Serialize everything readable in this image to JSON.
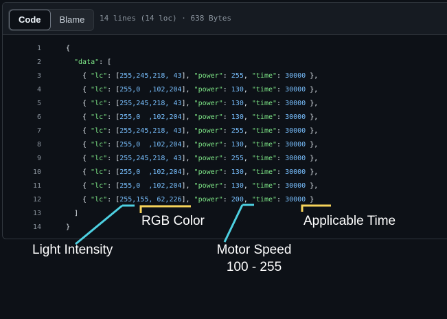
{
  "toolbar": {
    "tabs": [
      {
        "label": "Code",
        "active": true
      },
      {
        "label": "Blame",
        "active": false
      }
    ],
    "file_info": "14 lines (14 loc) · 638 Bytes"
  },
  "code_lines": [
    {
      "n": "1",
      "tokens": [
        [
          "pun",
          "{"
        ]
      ],
      "indent": 0
    },
    {
      "n": "2",
      "tokens": [
        [
          "key",
          "\"data\""
        ],
        [
          "pun",
          ": ["
        ]
      ],
      "indent": 1
    },
    {
      "n": "3",
      "tokens": [
        [
          "pun",
          "{ "
        ],
        [
          "key",
          "\"lc\""
        ],
        [
          "pun",
          ": ["
        ],
        [
          "num",
          "255,245,218, 43"
        ],
        [
          "pun",
          "], "
        ],
        [
          "key",
          "\"power\""
        ],
        [
          "pun",
          ": "
        ],
        [
          "num",
          "255"
        ],
        [
          "pun",
          ", "
        ],
        [
          "key",
          "\"time\""
        ],
        [
          "pun",
          ": "
        ],
        [
          "num",
          "30000"
        ],
        [
          "pun",
          " },"
        ]
      ],
      "indent": 2
    },
    {
      "n": "4",
      "tokens": [
        [
          "pun",
          "{ "
        ],
        [
          "key",
          "\"lc\""
        ],
        [
          "pun",
          ": ["
        ],
        [
          "num",
          "255,0  ,102,204"
        ],
        [
          "pun",
          "], "
        ],
        [
          "key",
          "\"power\""
        ],
        [
          "pun",
          ": "
        ],
        [
          "num",
          "130"
        ],
        [
          "pun",
          ", "
        ],
        [
          "key",
          "\"time\""
        ],
        [
          "pun",
          ": "
        ],
        [
          "num",
          "30000"
        ],
        [
          "pun",
          " },"
        ]
      ],
      "indent": 2
    },
    {
      "n": "5",
      "tokens": [
        [
          "pun",
          "{ "
        ],
        [
          "key",
          "\"lc\""
        ],
        [
          "pun",
          ": ["
        ],
        [
          "num",
          "255,245,218, 43"
        ],
        [
          "pun",
          "], "
        ],
        [
          "key",
          "\"power\""
        ],
        [
          "pun",
          ": "
        ],
        [
          "num",
          "130"
        ],
        [
          "pun",
          ", "
        ],
        [
          "key",
          "\"time\""
        ],
        [
          "pun",
          ": "
        ],
        [
          "num",
          "30000"
        ],
        [
          "pun",
          " },"
        ]
      ],
      "indent": 2
    },
    {
      "n": "6",
      "tokens": [
        [
          "pun",
          "{ "
        ],
        [
          "key",
          "\"lc\""
        ],
        [
          "pun",
          ": ["
        ],
        [
          "num",
          "255,0  ,102,204"
        ],
        [
          "pun",
          "], "
        ],
        [
          "key",
          "\"power\""
        ],
        [
          "pun",
          ": "
        ],
        [
          "num",
          "130"
        ],
        [
          "pun",
          ", "
        ],
        [
          "key",
          "\"time\""
        ],
        [
          "pun",
          ": "
        ],
        [
          "num",
          "30000"
        ],
        [
          "pun",
          " },"
        ]
      ],
      "indent": 2
    },
    {
      "n": "7",
      "tokens": [
        [
          "pun",
          "{ "
        ],
        [
          "key",
          "\"lc\""
        ],
        [
          "pun",
          ": ["
        ],
        [
          "num",
          "255,245,218, 43"
        ],
        [
          "pun",
          "], "
        ],
        [
          "key",
          "\"power\""
        ],
        [
          "pun",
          ": "
        ],
        [
          "num",
          "255"
        ],
        [
          "pun",
          ", "
        ],
        [
          "key",
          "\"time\""
        ],
        [
          "pun",
          ": "
        ],
        [
          "num",
          "30000"
        ],
        [
          "pun",
          " },"
        ]
      ],
      "indent": 2
    },
    {
      "n": "8",
      "tokens": [
        [
          "pun",
          "{ "
        ],
        [
          "key",
          "\"lc\""
        ],
        [
          "pun",
          ": ["
        ],
        [
          "num",
          "255,0  ,102,204"
        ],
        [
          "pun",
          "], "
        ],
        [
          "key",
          "\"power\""
        ],
        [
          "pun",
          ": "
        ],
        [
          "num",
          "130"
        ],
        [
          "pun",
          ", "
        ],
        [
          "key",
          "\"time\""
        ],
        [
          "pun",
          ": "
        ],
        [
          "num",
          "30000"
        ],
        [
          "pun",
          " },"
        ]
      ],
      "indent": 2
    },
    {
      "n": "9",
      "tokens": [
        [
          "pun",
          "{ "
        ],
        [
          "key",
          "\"lc\""
        ],
        [
          "pun",
          ": ["
        ],
        [
          "num",
          "255,245,218, 43"
        ],
        [
          "pun",
          "], "
        ],
        [
          "key",
          "\"power\""
        ],
        [
          "pun",
          ": "
        ],
        [
          "num",
          "255"
        ],
        [
          "pun",
          ", "
        ],
        [
          "key",
          "\"time\""
        ],
        [
          "pun",
          ": "
        ],
        [
          "num",
          "30000"
        ],
        [
          "pun",
          " },"
        ]
      ],
      "indent": 2
    },
    {
      "n": "10",
      "tokens": [
        [
          "pun",
          "{ "
        ],
        [
          "key",
          "\"lc\""
        ],
        [
          "pun",
          ": ["
        ],
        [
          "num",
          "255,0  ,102,204"
        ],
        [
          "pun",
          "], "
        ],
        [
          "key",
          "\"power\""
        ],
        [
          "pun",
          ": "
        ],
        [
          "num",
          "130"
        ],
        [
          "pun",
          ", "
        ],
        [
          "key",
          "\"time\""
        ],
        [
          "pun",
          ": "
        ],
        [
          "num",
          "30000"
        ],
        [
          "pun",
          " },"
        ]
      ],
      "indent": 2
    },
    {
      "n": "11",
      "tokens": [
        [
          "pun",
          "{ "
        ],
        [
          "key",
          "\"lc\""
        ],
        [
          "pun",
          ": ["
        ],
        [
          "num",
          "255,0  ,102,204"
        ],
        [
          "pun",
          "], "
        ],
        [
          "key",
          "\"power\""
        ],
        [
          "pun",
          ": "
        ],
        [
          "num",
          "130"
        ],
        [
          "pun",
          ", "
        ],
        [
          "key",
          "\"time\""
        ],
        [
          "pun",
          ": "
        ],
        [
          "num",
          "30000"
        ],
        [
          "pun",
          " },"
        ]
      ],
      "indent": 2
    },
    {
      "n": "12",
      "tokens": [
        [
          "pun",
          "{ "
        ],
        [
          "key",
          "\"lc\""
        ],
        [
          "pun",
          ": ["
        ],
        [
          "num",
          "255,155, 62,226"
        ],
        [
          "pun",
          "], "
        ],
        [
          "key",
          "\"power\""
        ],
        [
          "pun",
          ": "
        ],
        [
          "num",
          "200"
        ],
        [
          "pun",
          ", "
        ],
        [
          "key",
          "\"time\""
        ],
        [
          "pun",
          ": "
        ],
        [
          "num",
          "30000"
        ],
        [
          "pun",
          " }"
        ]
      ],
      "indent": 2
    },
    {
      "n": "13",
      "tokens": [
        [
          "pun",
          "]"
        ]
      ],
      "indent": 1
    },
    {
      "n": "14",
      "tokens": [
        [
          "pun",
          "}"
        ]
      ],
      "indent": 0
    }
  ],
  "annotations": {
    "rgb_color": "RGB Color",
    "applicable_time": "Applicable Time",
    "light_intensity": "Light Intensity",
    "motor_speed": "Motor Speed",
    "motor_speed_range": "100 - 255"
  },
  "colors": {
    "cyan_callout": "#4dd0e1",
    "yellow_callout": "#f6d35a"
  }
}
